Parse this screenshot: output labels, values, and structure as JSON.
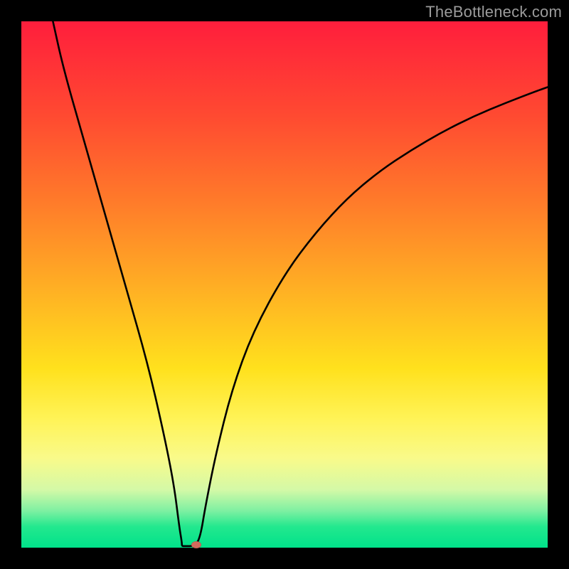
{
  "watermark": "TheBottleneck.com",
  "chart_data": {
    "type": "line",
    "title": "",
    "xlabel": "",
    "ylabel": "",
    "xlim": [
      0,
      100
    ],
    "ylim": [
      0,
      100
    ],
    "grid": false,
    "legend": false,
    "series": [
      {
        "name": "curve",
        "color": "#000000",
        "x": [
          6,
          8,
          12,
          16,
          20,
          24,
          27,
          29,
          30,
          30.5,
          30.5,
          31,
          33,
          34,
          35,
          37,
          40,
          44,
          50,
          56,
          62,
          68,
          74,
          80,
          86,
          92,
          98,
          100
        ],
        "y": [
          100,
          91,
          77,
          63,
          49,
          35,
          22,
          12,
          4,
          1,
          0.3,
          0.3,
          0.3,
          2,
          8,
          18,
          30,
          41,
          52,
          60,
          66.5,
          71.5,
          75.5,
          79,
          82,
          84.5,
          86.8,
          87.5
        ]
      }
    ],
    "marker": {
      "x": 33.2,
      "y": 0.5,
      "color": "#d26a5c"
    }
  }
}
